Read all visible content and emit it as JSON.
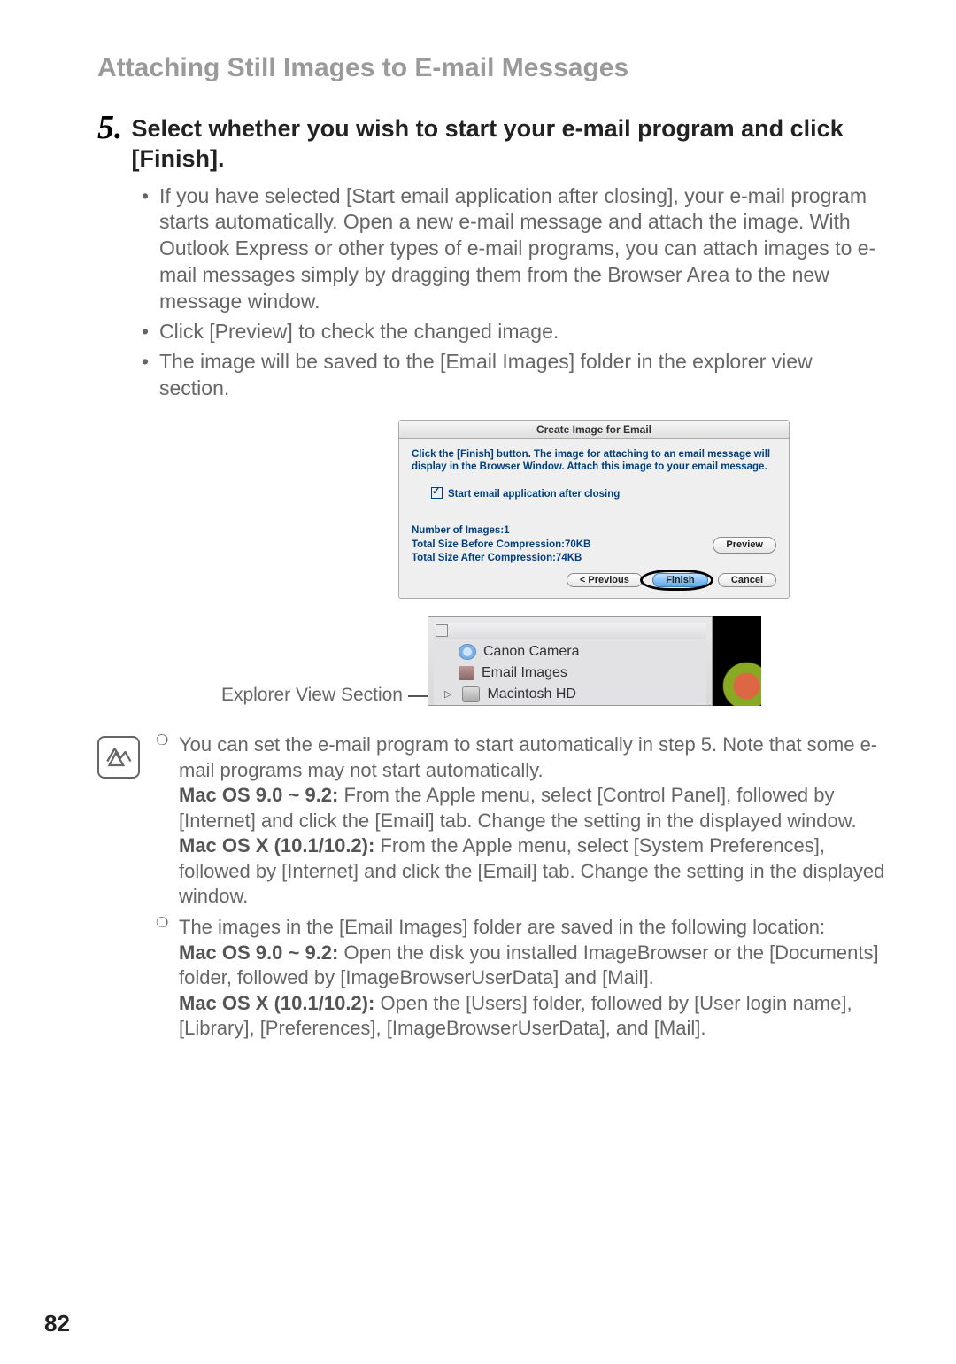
{
  "section_title": "Attaching Still Images to E-mail Messages",
  "step": {
    "number": "5.",
    "title": "Select whether you wish to start your e-mail program and click [Finish]."
  },
  "bullets": [
    "If you have selected [Start email application after closing], your e-mail program starts automatically. Open a new e-mail message and attach the image. With Outlook Express or other types of e-mail programs, you can attach images to e-mail messages simply by dragging them from the Browser Area to the new message window.",
    "Click [Preview] to check the changed image.",
    "The image will be saved to the [Email Images] folder in the explorer view section."
  ],
  "dialog": {
    "title": "Create Image for Email",
    "instruction": "Click the [Finish] button. The image for attaching to an email message will display in the Browser Window. Attach this image to your email message.",
    "checkbox_label": "Start email application after closing",
    "stats": {
      "count": "Number of Images:1",
      "before": "Total Size Before Compression:70KB",
      "after": "Total Size After Compression:74KB"
    },
    "buttons": {
      "preview": "Preview",
      "previous": "< Previous",
      "finish": "Finish",
      "cancel": "Cancel"
    }
  },
  "explorer": {
    "caption": "Explorer View Section",
    "items": [
      "Canon Camera",
      "Email Images",
      "Macintosh HD"
    ]
  },
  "notes": [
    {
      "lead": "You can set the e-mail program to start automatically in step 5. Note that some e-mail programs may not start automatically.",
      "mac9_label": "Mac OS 9.0 ~ 9.2:",
      "mac9_text": " From the Apple menu, select [Control Panel], followed by [Internet] and click the [Email] tab. Change the setting in the displayed window.",
      "macx_label": "Mac OS X (10.1/10.2):",
      "macx_text": " From the Apple menu, select [System Preferences], followed by [Internet] and click the [Email] tab. Change the setting in the displayed window."
    },
    {
      "lead": "The images in the [Email Images] folder are saved in the following location:",
      "mac9_label": "Mac OS 9.0 ~ 9.2:",
      "mac9_text": " Open the disk you installed ImageBrowser or the [Documents] folder, followed by [ImageBrowserUserData] and [Mail].",
      "macx_label": "Mac OS X (10.1/10.2):",
      "macx_text": " Open the [Users] folder, followed by [User login name], [Library], [Preferences], [ImageBrowserUserData], and [Mail]."
    }
  ],
  "page_number": "82"
}
